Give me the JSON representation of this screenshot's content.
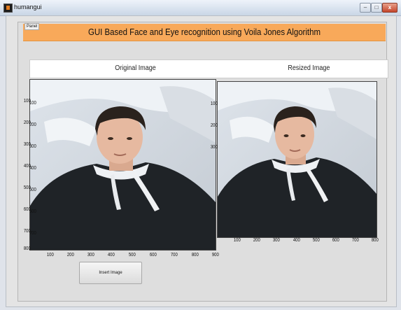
{
  "window": {
    "title": "humangui",
    "min_label": "–",
    "max_label": "□",
    "close_label": "x"
  },
  "panel": {
    "label": "Panel",
    "title": "GUI Based Face and Eye recognition using Voila Jones Algorithm"
  },
  "labels": {
    "original": "Original Image",
    "resized": "Resized Image"
  },
  "axes1": {
    "yticks": [
      "100",
      "200",
      "300",
      "400",
      "500",
      "600",
      "700",
      "800"
    ],
    "xticks": [
      "100",
      "200",
      "300",
      "400",
      "500",
      "600",
      "700",
      "800",
      "900"
    ]
  },
  "axes2": {
    "yticks": [
      "100",
      "200",
      "300"
    ],
    "xticks": [
      "100",
      "200",
      "300",
      "400",
      "500",
      "600",
      "700",
      "800"
    ]
  },
  "buttons": {
    "insert": "Insert Image"
  },
  "icons": {
    "app": "matlab-figure-icon",
    "face_photo": "person-photo"
  },
  "colors": {
    "header": "#f8a95a",
    "panel": "#dedede",
    "hoodie": "#1f2327"
  }
}
